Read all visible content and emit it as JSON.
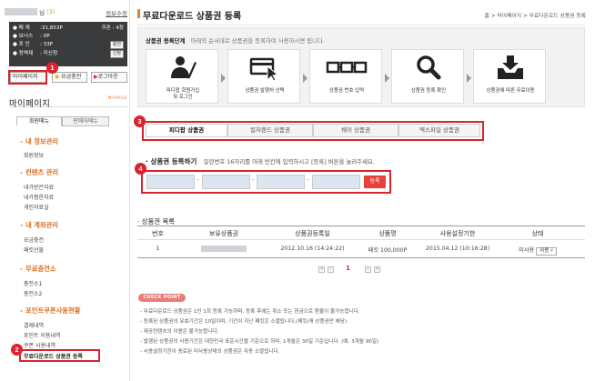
{
  "user": {
    "name_suffix": "님",
    "level": "(3)",
    "info_link": "정보수정",
    "stats": [
      {
        "key": "● 패  캐",
        "value": ":31,853P",
        "right": "쿠폰 : 4장",
        "right_badge": ""
      },
      {
        "key": "● 보너스",
        "value": ": 0P",
        "right": "",
        "right_badge": ""
      },
      {
        "key": "● 포  인",
        "value": ": 33P",
        "right": "",
        "right_badge": "충전"
      },
      {
        "key": "● 정액제",
        "value": ": 미신청",
        "right": "",
        "right_badge": "신청"
      }
    ],
    "buttons": {
      "mypage": "마이페이지",
      "charge": "요금충전",
      "logout": "로그아웃"
    }
  },
  "sidebar": {
    "title": "마이페이지",
    "title_sub": "MYPAGE",
    "tabs": [
      "회원메뉴",
      "판매자메뉴"
    ],
    "sections": [
      {
        "title": "내 정보관리",
        "items": [
          "회원정보"
        ]
      },
      {
        "title": "컨텐츠 관리",
        "items": [
          "내가받은자료",
          "내가찜한자료",
          "개인자료실"
        ]
      },
      {
        "title": "내 계좌관리",
        "items": [
          "요금충전",
          "패킷선물"
        ]
      },
      {
        "title": "무료충전소",
        "items": [
          "충전소1",
          "충전소2"
        ]
      },
      {
        "title": "포인트쿠폰사용현황",
        "items": [
          "결제내역",
          "포인트 이용내역",
          "쿠폰 사용내역",
          "무료다운로드 상품권 등록"
        ]
      }
    ]
  },
  "markers": [
    "1",
    "2",
    "3",
    "4"
  ],
  "page": {
    "title": "무료다운로드 상품권 등록",
    "breadcrumb": [
      "홈",
      "마이페이지",
      "무료다운로드 상품권 등록"
    ],
    "breadcrumb_sep": ">"
  },
  "steps": {
    "title": "상품권 등록단계",
    "desc": "아래의 순서대로 상품권을 등록하여 사용하시면 됩니다.",
    "items": [
      {
        "label1": "피디팝 회원가입",
        "label2": "및 로그인",
        "icon": "person-pen-icon"
      },
      {
        "label1": "상품권 발행처 선택",
        "label2": "",
        "icon": "card-cursor-icon"
      },
      {
        "label1": "상품권 번호 입력",
        "label2": "",
        "icon": "serial-boxes-icon"
      },
      {
        "label1": "상품권 등록 확인",
        "label2": "",
        "icon": "magnifier-icon"
      },
      {
        "label1": "상품권에 따른 무료이용",
        "label2": "",
        "icon": "download-tray-icon"
      }
    ]
  },
  "voucher_tabs": [
    "피디팝 상품권",
    "컬처랜드 상품권",
    "쉐어 상품권",
    "엑스파일 상품권"
  ],
  "register": {
    "title": "· 상품권 등록하기",
    "desc": "일련번호 16자리를 아래 빈칸에 입력하시고 [등록] 버튼을 눌러주세요.",
    "button": "등록",
    "serial_values": [
      "",
      "",
      "",
      ""
    ],
    "separator": "-"
  },
  "list": {
    "title": "· 상품권 목록",
    "columns": [
      "번호",
      "보유상품권",
      "상품권등록일",
      "상품명",
      "사용설정기한",
      "상태"
    ],
    "rows": [
      {
        "no": "1",
        "registered": "2012.10.16 (14:24:22)",
        "product": "패킷 100,000P",
        "expires": "2015.04.12 (10:16:28)",
        "status": "미사용",
        "select": "사용",
        "select_caret": "▾"
      }
    ]
  },
  "pagination": {
    "current": "1",
    "first": "«",
    "prev": "‹",
    "next": "›",
    "last": "»"
  },
  "check_point": {
    "badge": "CHECK POINT",
    "notes": [
      "- 무료다운로드 상품권은 1인 1회 등록 가능하며, 등록 후에는 취소 또는 현금으로 환불이 불가능합니다.",
      "- 등록된 상품권의 유효기간은 10일이며, 기간이 지난 패킷은 소멸됩니다.(패킷/캐 상품권만 해당)",
      "- 제공컨텐츠의 이용은 불가능합니다.",
      "- 발행된 상품권의 사용기간은 대한민국 표준시간을 기준으로 하며, 1개월은 30일 기준입니다. (예: 3개월 90일)",
      "- 사용설정기한이 종료된 미사용상태의 상품권은 자동 소멸됩니다."
    ]
  },
  "colors": {
    "accent_red": "#d9232d",
    "orange": "#d96d1e",
    "dark_panel": "#3a3b3d",
    "serial_fill": "#dbe6f1"
  }
}
